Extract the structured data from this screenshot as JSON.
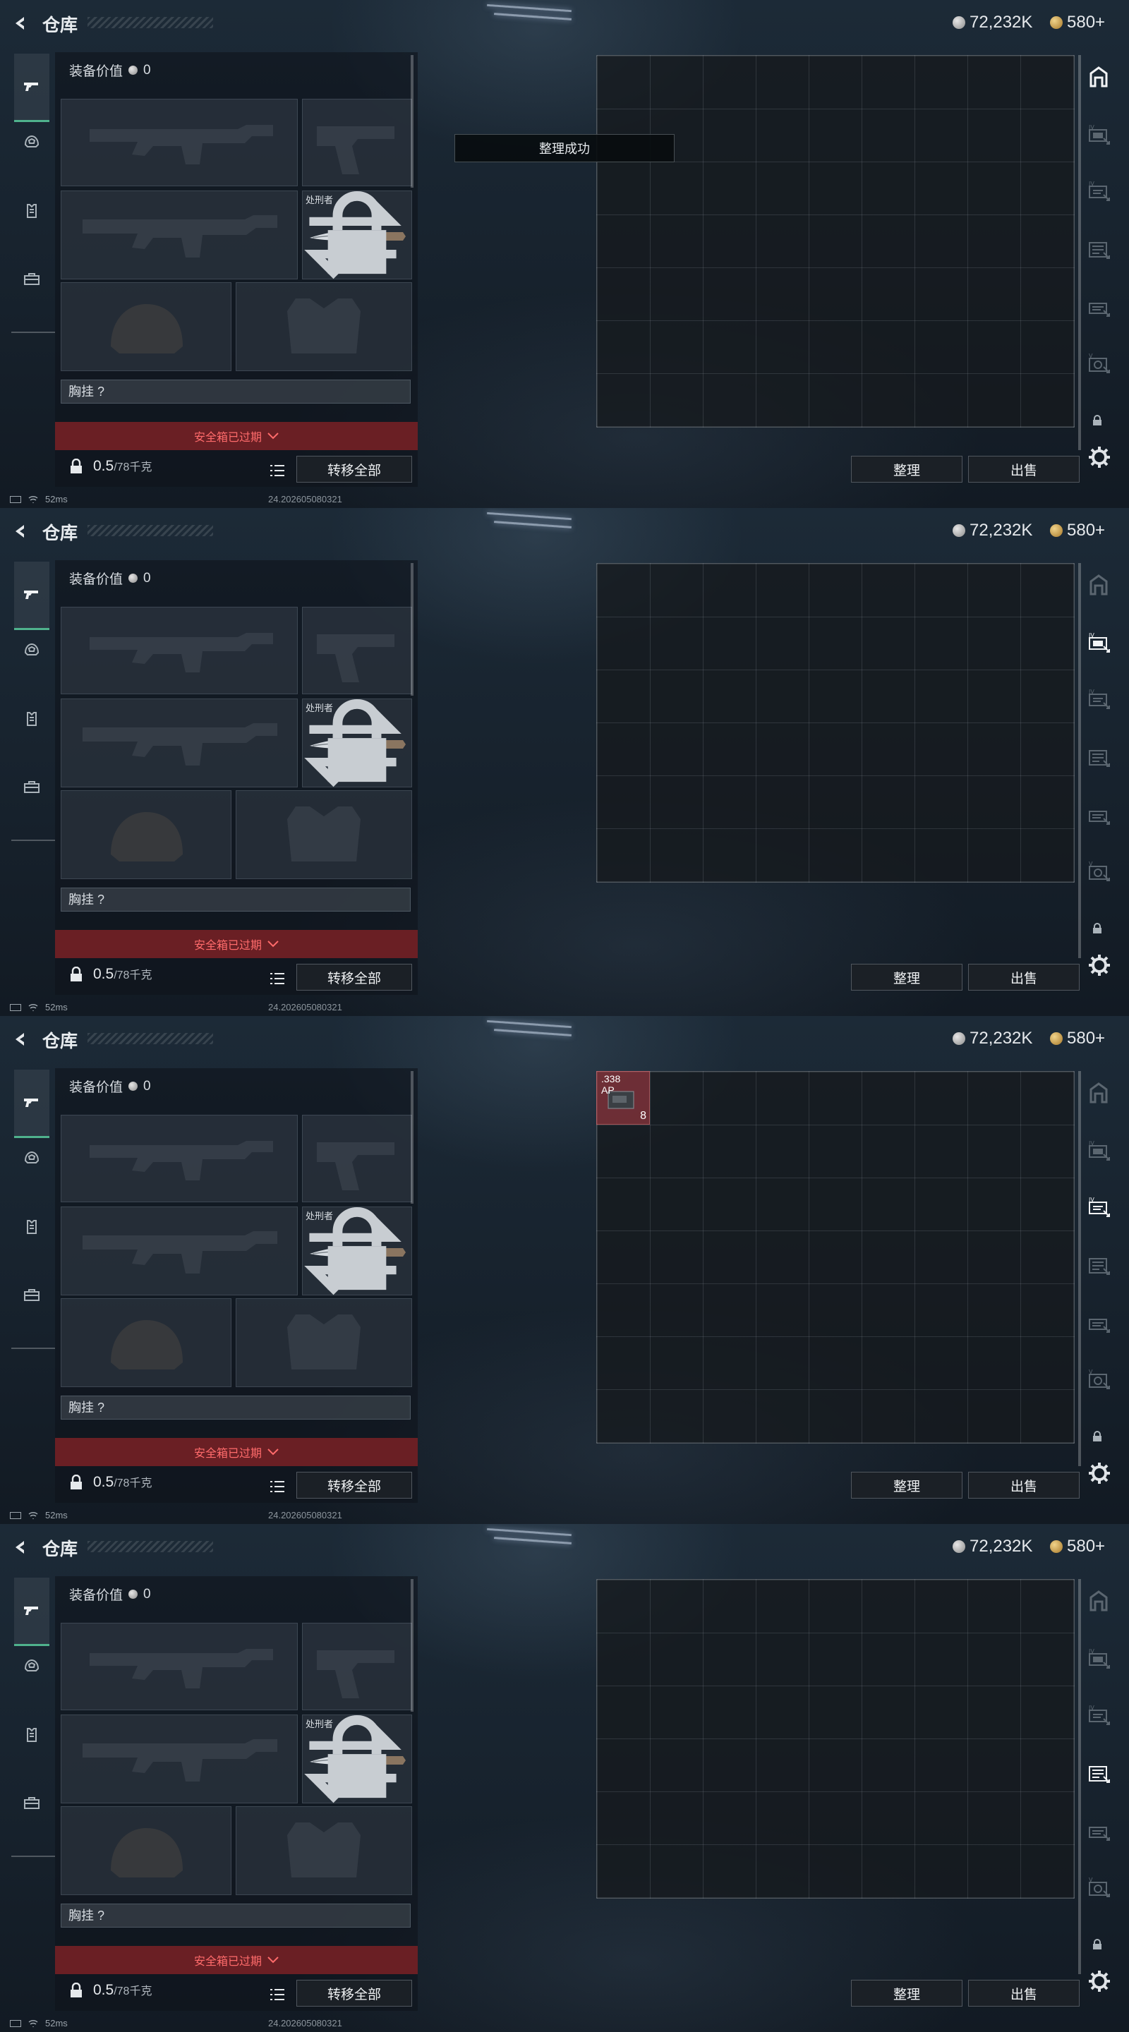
{
  "panels": [
    {
      "title": "仓库",
      "currency": {
        "silver": "72,232K",
        "gold": "580+"
      },
      "equip_value_label": "装备价值",
      "equip_value": "0",
      "knife_label": "处刑者",
      "chest_rig": "胸挂 ?",
      "safe_box": "安全箱已过期",
      "weight": "0.5",
      "weight_max": "/78千克",
      "transfer_all": "转移全部",
      "sort": "整理",
      "sell": "出售",
      "status_ping": "52ms",
      "build": "24.202605080321",
      "toast": "整理成功",
      "active_tab": 0,
      "grid_rows": 7,
      "item": null
    },
    {
      "title": "仓库",
      "currency": {
        "silver": "72,232K",
        "gold": "580+"
      },
      "equip_value_label": "装备价值",
      "equip_value": "0",
      "knife_label": "处刑者",
      "chest_rig": "胸挂 ?",
      "safe_box": "安全箱已过期",
      "weight": "0.5",
      "weight_max": "/78千克",
      "transfer_all": "转移全部",
      "sort": "整理",
      "sell": "出售",
      "status_ping": "52ms",
      "build": "24.202605080321",
      "toast": "",
      "active_tab": 1,
      "grid_rows": 6,
      "item": null
    },
    {
      "title": "仓库",
      "currency": {
        "silver": "72,232K",
        "gold": "580+"
      },
      "equip_value_label": "装备价值",
      "equip_value": "0",
      "knife_label": "处刑者",
      "chest_rig": "胸挂 ?",
      "safe_box": "安全箱已过期",
      "weight": "0.5",
      "weight_max": "/78千克",
      "transfer_all": "转移全部",
      "sort": "整理",
      "sell": "出售",
      "status_ping": "52ms",
      "build": "24.202605080321",
      "toast": "",
      "active_tab": 2,
      "grid_rows": 7,
      "item": {
        "line1": ".338",
        "line2": "AP",
        "count": "8"
      }
    },
    {
      "title": "仓库",
      "currency": {
        "silver": "72,232K",
        "gold": "580+"
      },
      "equip_value_label": "装备价值",
      "equip_value": "0",
      "knife_label": "处刑者",
      "chest_rig": "胸挂 ?",
      "safe_box": "安全箱已过期",
      "weight": "0.5",
      "weight_max": "/78千克",
      "transfer_all": "转移全部",
      "sort": "整理",
      "sell": "出售",
      "status_ping": "52ms",
      "build": "24.202605080321",
      "toast": "",
      "active_tab": 3,
      "grid_rows": 6,
      "item": null
    }
  ],
  "icons": {
    "left_nav": [
      "pistol-icon",
      "helmet-icon",
      "armor-icon",
      "briefcase-icon"
    ],
    "right_nav": [
      "stash-icon",
      "storage-tab-4-icon",
      "storage-tab-5-icon",
      "storage-tab-6-icon",
      "storage-tab-7-icon",
      "storage-tab-8-icon"
    ]
  },
  "colors": {
    "accent_green": "#4fb28d",
    "safe_red": "#6a1f24",
    "safe_text": "#ff6b6b"
  }
}
